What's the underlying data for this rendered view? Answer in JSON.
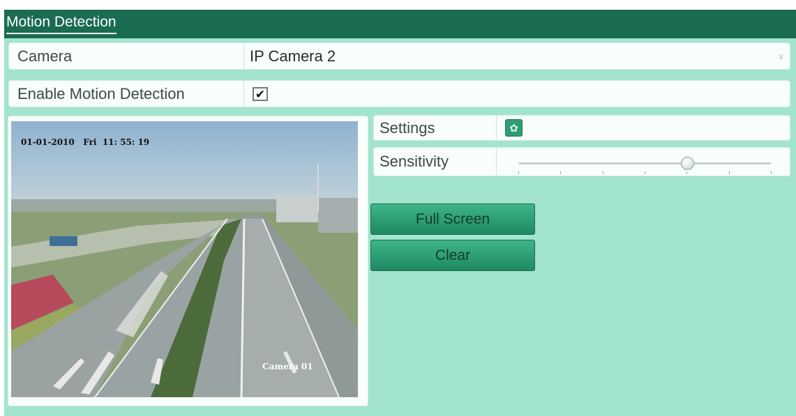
{
  "window": {
    "title": "Motion Detection"
  },
  "camera": {
    "label": "Camera",
    "value": "IP Camera 2",
    "dropdown_icon": "chevron-down-icon"
  },
  "enable": {
    "label": "Enable Motion Detection",
    "checked": true,
    "check_glyph": "✔"
  },
  "video": {
    "osd_datetime": "01-01-2010   Fri  11: 55: 19",
    "osd_camera": "Camera 01"
  },
  "settings": {
    "label": "Settings",
    "icon": "gear-icon",
    "icon_glyph": "✿"
  },
  "sensitivity": {
    "label": "Sensitivity",
    "level": 0.67,
    "ticks": 7
  },
  "buttons": {
    "full_screen": "Full Screen",
    "clear": "Clear"
  },
  "colors": {
    "titlebar": "#1a6b51",
    "background": "#a3e4cf",
    "button": "#2f9e74"
  }
}
